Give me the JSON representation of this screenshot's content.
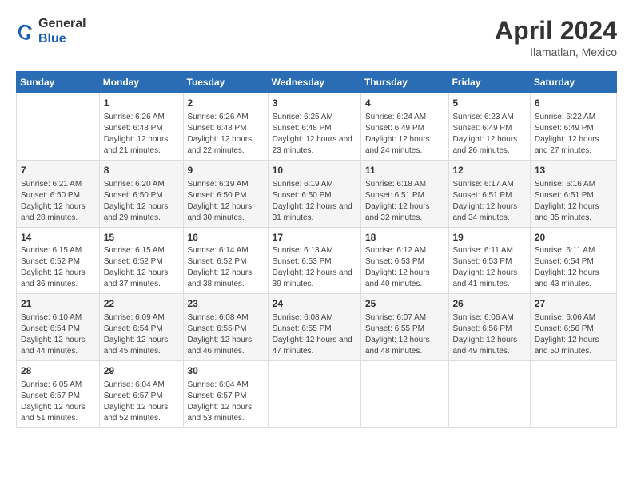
{
  "logo": {
    "general": "General",
    "blue": "Blue"
  },
  "title": "April 2024",
  "subtitle": "Ilamatlan, Mexico",
  "header_days": [
    "Sunday",
    "Monday",
    "Tuesday",
    "Wednesday",
    "Thursday",
    "Friday",
    "Saturday"
  ],
  "weeks": [
    [
      {
        "num": "",
        "sunrise": "",
        "sunset": "",
        "daylight": ""
      },
      {
        "num": "1",
        "sunrise": "Sunrise: 6:26 AM",
        "sunset": "Sunset: 6:48 PM",
        "daylight": "Daylight: 12 hours and 21 minutes."
      },
      {
        "num": "2",
        "sunrise": "Sunrise: 6:26 AM",
        "sunset": "Sunset: 6:48 PM",
        "daylight": "Daylight: 12 hours and 22 minutes."
      },
      {
        "num": "3",
        "sunrise": "Sunrise: 6:25 AM",
        "sunset": "Sunset: 6:48 PM",
        "daylight": "Daylight: 12 hours and 23 minutes."
      },
      {
        "num": "4",
        "sunrise": "Sunrise: 6:24 AM",
        "sunset": "Sunset: 6:49 PM",
        "daylight": "Daylight: 12 hours and 24 minutes."
      },
      {
        "num": "5",
        "sunrise": "Sunrise: 6:23 AM",
        "sunset": "Sunset: 6:49 PM",
        "daylight": "Daylight: 12 hours and 26 minutes."
      },
      {
        "num": "6",
        "sunrise": "Sunrise: 6:22 AM",
        "sunset": "Sunset: 6:49 PM",
        "daylight": "Daylight: 12 hours and 27 minutes."
      }
    ],
    [
      {
        "num": "7",
        "sunrise": "Sunrise: 6:21 AM",
        "sunset": "Sunset: 6:50 PM",
        "daylight": "Daylight: 12 hours and 28 minutes."
      },
      {
        "num": "8",
        "sunrise": "Sunrise: 6:20 AM",
        "sunset": "Sunset: 6:50 PM",
        "daylight": "Daylight: 12 hours and 29 minutes."
      },
      {
        "num": "9",
        "sunrise": "Sunrise: 6:19 AM",
        "sunset": "Sunset: 6:50 PM",
        "daylight": "Daylight: 12 hours and 30 minutes."
      },
      {
        "num": "10",
        "sunrise": "Sunrise: 6:19 AM",
        "sunset": "Sunset: 6:50 PM",
        "daylight": "Daylight: 12 hours and 31 minutes."
      },
      {
        "num": "11",
        "sunrise": "Sunrise: 6:18 AM",
        "sunset": "Sunset: 6:51 PM",
        "daylight": "Daylight: 12 hours and 32 minutes."
      },
      {
        "num": "12",
        "sunrise": "Sunrise: 6:17 AM",
        "sunset": "Sunset: 6:51 PM",
        "daylight": "Daylight: 12 hours and 34 minutes."
      },
      {
        "num": "13",
        "sunrise": "Sunrise: 6:16 AM",
        "sunset": "Sunset: 6:51 PM",
        "daylight": "Daylight: 12 hours and 35 minutes."
      }
    ],
    [
      {
        "num": "14",
        "sunrise": "Sunrise: 6:15 AM",
        "sunset": "Sunset: 6:52 PM",
        "daylight": "Daylight: 12 hours and 36 minutes."
      },
      {
        "num": "15",
        "sunrise": "Sunrise: 6:15 AM",
        "sunset": "Sunset: 6:52 PM",
        "daylight": "Daylight: 12 hours and 37 minutes."
      },
      {
        "num": "16",
        "sunrise": "Sunrise: 6:14 AM",
        "sunset": "Sunset: 6:52 PM",
        "daylight": "Daylight: 12 hours and 38 minutes."
      },
      {
        "num": "17",
        "sunrise": "Sunrise: 6:13 AM",
        "sunset": "Sunset: 6:53 PM",
        "daylight": "Daylight: 12 hours and 39 minutes."
      },
      {
        "num": "18",
        "sunrise": "Sunrise: 6:12 AM",
        "sunset": "Sunset: 6:53 PM",
        "daylight": "Daylight: 12 hours and 40 minutes."
      },
      {
        "num": "19",
        "sunrise": "Sunrise: 6:11 AM",
        "sunset": "Sunset: 6:53 PM",
        "daylight": "Daylight: 12 hours and 41 minutes."
      },
      {
        "num": "20",
        "sunrise": "Sunrise: 6:11 AM",
        "sunset": "Sunset: 6:54 PM",
        "daylight": "Daylight: 12 hours and 43 minutes."
      }
    ],
    [
      {
        "num": "21",
        "sunrise": "Sunrise: 6:10 AM",
        "sunset": "Sunset: 6:54 PM",
        "daylight": "Daylight: 12 hours and 44 minutes."
      },
      {
        "num": "22",
        "sunrise": "Sunrise: 6:09 AM",
        "sunset": "Sunset: 6:54 PM",
        "daylight": "Daylight: 12 hours and 45 minutes."
      },
      {
        "num": "23",
        "sunrise": "Sunrise: 6:08 AM",
        "sunset": "Sunset: 6:55 PM",
        "daylight": "Daylight: 12 hours and 46 minutes."
      },
      {
        "num": "24",
        "sunrise": "Sunrise: 6:08 AM",
        "sunset": "Sunset: 6:55 PM",
        "daylight": "Daylight: 12 hours and 47 minutes."
      },
      {
        "num": "25",
        "sunrise": "Sunrise: 6:07 AM",
        "sunset": "Sunset: 6:55 PM",
        "daylight": "Daylight: 12 hours and 48 minutes."
      },
      {
        "num": "26",
        "sunrise": "Sunrise: 6:06 AM",
        "sunset": "Sunset: 6:56 PM",
        "daylight": "Daylight: 12 hours and 49 minutes."
      },
      {
        "num": "27",
        "sunrise": "Sunrise: 6:06 AM",
        "sunset": "Sunset: 6:56 PM",
        "daylight": "Daylight: 12 hours and 50 minutes."
      }
    ],
    [
      {
        "num": "28",
        "sunrise": "Sunrise: 6:05 AM",
        "sunset": "Sunset: 6:57 PM",
        "daylight": "Daylight: 12 hours and 51 minutes."
      },
      {
        "num": "29",
        "sunrise": "Sunrise: 6:04 AM",
        "sunset": "Sunset: 6:57 PM",
        "daylight": "Daylight: 12 hours and 52 minutes."
      },
      {
        "num": "30",
        "sunrise": "Sunrise: 6:04 AM",
        "sunset": "Sunset: 6:57 PM",
        "daylight": "Daylight: 12 hours and 53 minutes."
      },
      {
        "num": "",
        "sunrise": "",
        "sunset": "",
        "daylight": ""
      },
      {
        "num": "",
        "sunrise": "",
        "sunset": "",
        "daylight": ""
      },
      {
        "num": "",
        "sunrise": "",
        "sunset": "",
        "daylight": ""
      },
      {
        "num": "",
        "sunrise": "",
        "sunset": "",
        "daylight": ""
      }
    ]
  ]
}
